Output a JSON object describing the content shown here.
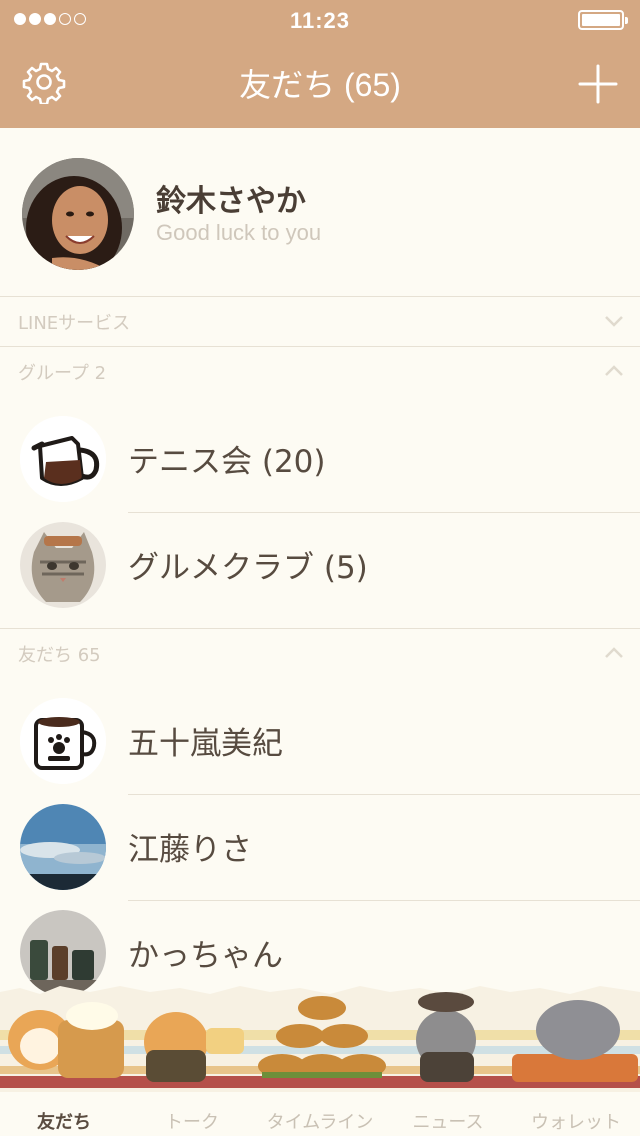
{
  "status_bar": {
    "time": "11:23",
    "signal_dots": [
      true,
      true,
      true,
      false,
      false
    ],
    "battery_level": 1.0
  },
  "header": {
    "title": "友だち (65)",
    "left_icon": "gear-icon",
    "right_icon": "plus-icon"
  },
  "profile": {
    "name": "鈴木さやか",
    "status_message": "Good luck to you"
  },
  "sections": {
    "line_services": {
      "label": "LINEサービス",
      "state": "collapsed"
    },
    "groups": {
      "label": "グループ 2",
      "state": "expanded"
    },
    "friends": {
      "label": "友だち 65",
      "state": "expanded"
    }
  },
  "groups": [
    {
      "name": "テニス会 (20)",
      "icon": "coffee-pot-icon"
    },
    {
      "name": "グルメクラブ (5)",
      "icon": "cat-photo"
    }
  ],
  "friends": [
    {
      "name": "五十嵐美紀",
      "icon": "coffee-cup-icon"
    },
    {
      "name": "江藤りさ",
      "icon": "sky-photo"
    },
    {
      "name": "かっちゃん",
      "icon": "jars-photo"
    }
  ],
  "tabs": [
    {
      "label": "友だち",
      "active": true
    },
    {
      "label": "トーク",
      "active": false
    },
    {
      "label": "タイムライン",
      "active": false
    },
    {
      "label": "ニュース",
      "active": false
    },
    {
      "label": "ウォレット",
      "active": false
    }
  ],
  "colors": {
    "header_bg": "#d4a883",
    "body_bg": "#fdfbf3",
    "text": "#574b40",
    "muted": "#d3cbbf"
  }
}
